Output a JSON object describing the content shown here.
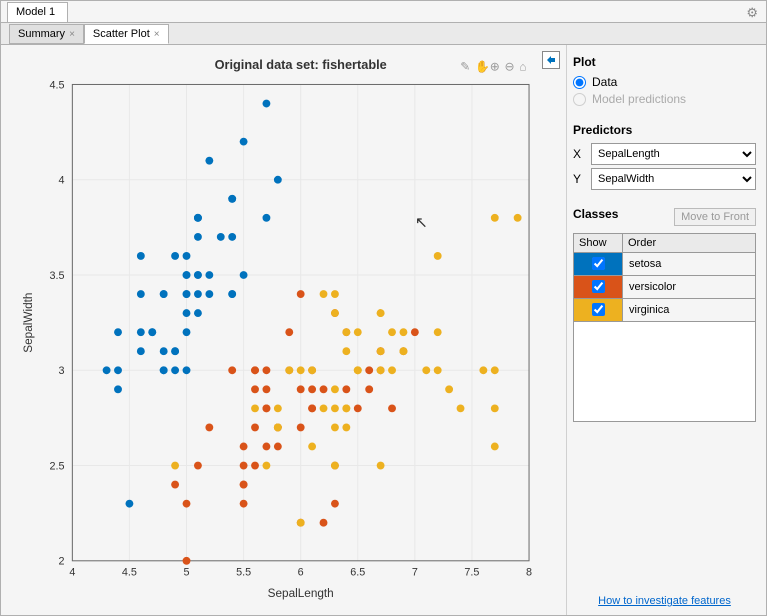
{
  "window": {
    "title": "Model 1"
  },
  "tabs": [
    {
      "label": "Summary",
      "active": false
    },
    {
      "label": "Scatter Plot",
      "active": true
    }
  ],
  "chart_data": {
    "type": "scatter",
    "title": "Original data set: fishertable",
    "xlabel": "SepalLength",
    "ylabel": "SepalWidth",
    "xlim": [
      4,
      8
    ],
    "ylim": [
      2,
      4.5
    ],
    "xticks": [
      4,
      4.5,
      5,
      5.5,
      6,
      6.5,
      7,
      7.5,
      8
    ],
    "yticks": [
      2,
      2.5,
      3,
      3.5,
      4,
      4.5
    ],
    "series": [
      {
        "name": "setosa",
        "color": "#0072bd",
        "x": [
          5.1,
          4.9,
          4.7,
          4.6,
          5.0,
          5.4,
          4.6,
          5.0,
          4.4,
          4.9,
          5.4,
          4.8,
          4.8,
          4.3,
          5.8,
          5.7,
          5.4,
          5.1,
          5.7,
          5.1,
          5.4,
          5.1,
          4.6,
          5.1,
          4.8,
          5.0,
          5.0,
          5.2,
          5.2,
          4.7,
          4.8,
          5.4,
          5.2,
          5.5,
          4.9,
          5.0,
          5.5,
          4.9,
          4.4,
          5.1,
          5.0,
          4.5,
          4.4,
          5.0,
          5.1,
          4.8,
          5.1,
          4.6,
          5.3,
          5.0
        ],
        "y": [
          3.5,
          3.0,
          3.2,
          3.1,
          3.6,
          3.9,
          3.4,
          3.4,
          2.9,
          3.1,
          3.7,
          3.4,
          3.0,
          3.0,
          4.0,
          4.4,
          3.9,
          3.5,
          3.8,
          3.8,
          3.4,
          3.7,
          3.6,
          3.3,
          3.4,
          3.0,
          3.4,
          3.5,
          3.4,
          3.2,
          3.1,
          3.4,
          4.1,
          4.2,
          3.1,
          3.2,
          3.5,
          3.6,
          3.0,
          3.4,
          3.5,
          2.3,
          3.2,
          3.5,
          3.8,
          3.0,
          3.8,
          3.2,
          3.7,
          3.3
        ]
      },
      {
        "name": "versicolor",
        "color": "#d95319",
        "x": [
          7.0,
          6.4,
          6.9,
          5.5,
          6.5,
          5.7,
          6.3,
          4.9,
          6.6,
          5.2,
          5.0,
          5.9,
          6.0,
          6.1,
          5.6,
          6.7,
          5.6,
          5.8,
          6.2,
          5.6,
          5.9,
          6.1,
          6.3,
          6.1,
          6.4,
          6.6,
          6.8,
          6.7,
          6.0,
          5.7,
          5.5,
          5.5,
          5.8,
          6.0,
          5.4,
          6.0,
          6.7,
          6.3,
          5.6,
          5.5,
          5.5,
          6.1,
          5.8,
          5.0,
          5.6,
          5.7,
          5.7,
          6.2,
          5.1,
          5.7
        ],
        "y": [
          3.2,
          3.2,
          3.1,
          2.3,
          2.8,
          2.8,
          3.3,
          2.4,
          2.9,
          2.7,
          2.0,
          3.0,
          2.2,
          2.9,
          2.9,
          3.1,
          3.0,
          2.7,
          2.2,
          2.5,
          3.2,
          2.8,
          2.5,
          2.8,
          2.9,
          3.0,
          2.8,
          3.0,
          2.9,
          2.6,
          2.4,
          2.4,
          2.7,
          2.7,
          3.0,
          3.4,
          3.1,
          2.3,
          3.0,
          2.5,
          2.6,
          3.0,
          2.6,
          2.3,
          2.7,
          3.0,
          2.9,
          2.9,
          2.5,
          2.8
        ]
      },
      {
        "name": "virginica",
        "color": "#edb120",
        "x": [
          6.3,
          5.8,
          7.1,
          6.3,
          6.5,
          7.6,
          4.9,
          7.3,
          6.7,
          7.2,
          6.5,
          6.4,
          6.8,
          5.7,
          5.8,
          6.4,
          6.5,
          7.7,
          7.7,
          6.0,
          6.9,
          5.6,
          7.7,
          6.3,
          6.7,
          7.2,
          6.2,
          6.1,
          6.4,
          7.2,
          7.4,
          7.9,
          6.4,
          6.3,
          6.1,
          7.7,
          6.3,
          6.4,
          6.0,
          6.9,
          6.7,
          6.9,
          5.8,
          6.8,
          6.7,
          6.7,
          6.3,
          6.5,
          6.2,
          5.9
        ],
        "y": [
          3.3,
          2.7,
          3.0,
          2.9,
          3.0,
          3.0,
          2.5,
          2.9,
          2.5,
          3.6,
          3.2,
          2.7,
          3.0,
          2.5,
          2.8,
          3.2,
          3.0,
          3.8,
          2.6,
          2.2,
          3.2,
          2.8,
          2.8,
          2.7,
          3.3,
          3.2,
          2.8,
          3.0,
          2.8,
          3.0,
          2.8,
          3.8,
          2.8,
          2.8,
          2.6,
          3.0,
          3.4,
          3.1,
          3.0,
          3.1,
          3.1,
          3.1,
          2.7,
          3.2,
          3.3,
          3.0,
          2.5,
          3.0,
          3.4,
          3.0
        ]
      }
    ]
  },
  "side": {
    "plot_label": "Plot",
    "radio_data": "Data",
    "radio_pred": "Model predictions",
    "predictors_label": "Predictors",
    "x_label": "X",
    "y_label": "Y",
    "x_value": "SepalLength",
    "y_value": "SepalWidth",
    "classes_label": "Classes",
    "move_btn": "Move to Front",
    "th_show": "Show",
    "th_order": "Order",
    "classes": [
      {
        "name": "setosa",
        "color": "#0072bd",
        "checked": true
      },
      {
        "name": "versicolor",
        "color": "#d95319",
        "checked": true
      },
      {
        "name": "virginica",
        "color": "#edb120",
        "checked": true
      }
    ],
    "link": "How to investigate features"
  }
}
